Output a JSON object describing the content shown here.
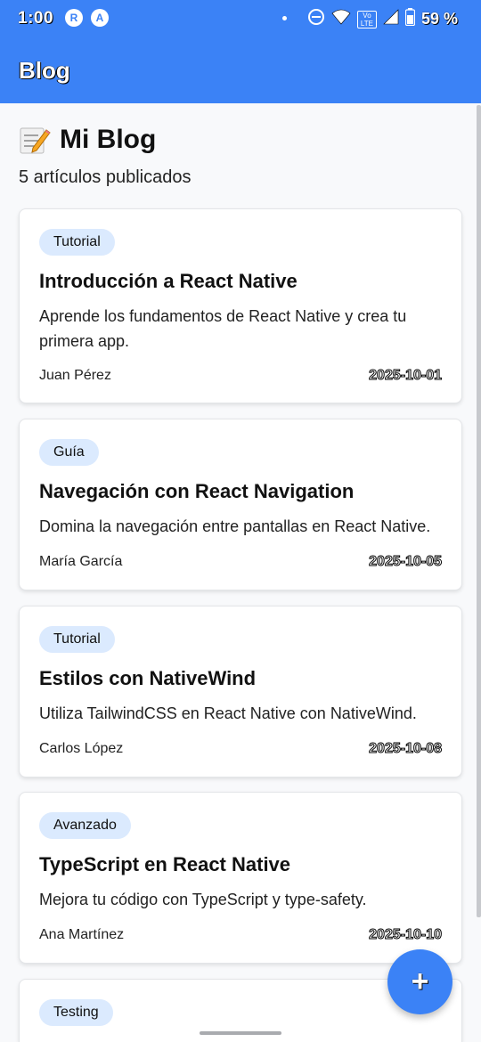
{
  "status_bar": {
    "time": "1:00",
    "battery_percent": "59 %",
    "network_label_top": "Vo",
    "network_label_bottom": "LTE",
    "icons": [
      "app-r-icon",
      "app-a-icon",
      "notification-dot",
      "dnd-icon",
      "wifi-icon",
      "volte-icon",
      "signal-icon",
      "battery-icon"
    ],
    "app_icon_1": "R",
    "app_icon_2": "A"
  },
  "app_bar": {
    "title": "Blog"
  },
  "header": {
    "emoji_icon": "memo-icon",
    "title": "Mi Blog",
    "subtitle": "5 artículos publicados"
  },
  "articles": [
    {
      "category": "Tutorial",
      "title": "Introducción a React Native",
      "description": "Aprende los fundamentos de React Native y crea tu primera app.",
      "author": "Juan Pérez",
      "date": "2025-10-01"
    },
    {
      "category": "Guía",
      "title": "Navegación con React Navigation",
      "description": "Domina la navegación entre pantallas en React Native.",
      "author": "María García",
      "date": "2025-10-05"
    },
    {
      "category": "Tutorial",
      "title": "Estilos con NativeWind",
      "description": "Utiliza TailwindCSS en React Native con NativeWind.",
      "author": "Carlos López",
      "date": "2025-10-08"
    },
    {
      "category": "Avanzado",
      "title": "TypeScript en React Native",
      "description": "Mejora tu código con TypeScript y type-safety.",
      "author": "Ana Martínez",
      "date": "2025-10-10"
    },
    {
      "category": "Testing"
    }
  ],
  "fab": {
    "icon": "plus-icon",
    "label": "+"
  },
  "colors": {
    "primary": "#3b82f6",
    "badge_bg": "#dbeafe",
    "background": "#f8f9fb",
    "card_bg": "#ffffff"
  }
}
